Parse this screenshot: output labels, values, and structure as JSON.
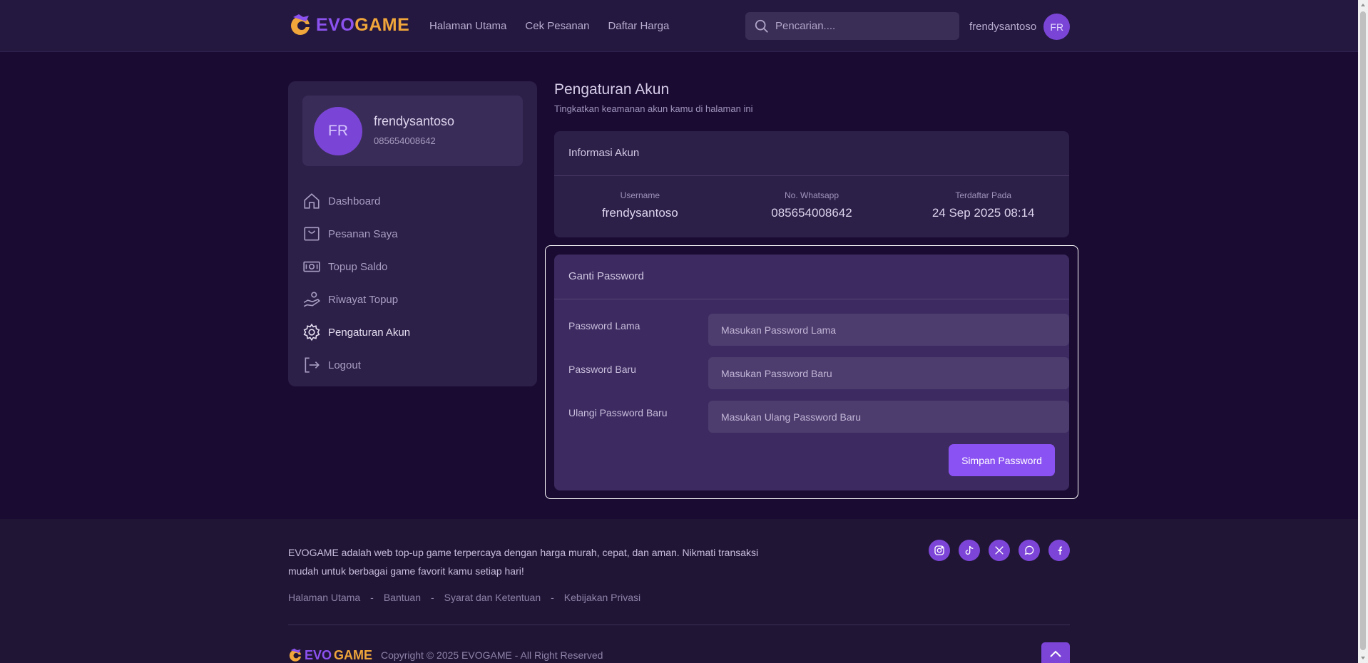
{
  "brand": {
    "part1": "EVO",
    "part2": "GAME",
    "accent": "#8b52f3",
    "orange": "#f0a63a"
  },
  "nav": {
    "links": [
      "Halaman Utama",
      "Cek Pesanan",
      "Daftar Harga"
    ],
    "search_placeholder": "Pencarian....",
    "username": "frendysantoso",
    "avatar_initials": "FR"
  },
  "sidebar": {
    "profile": {
      "initials": "FR",
      "name": "frendysantoso",
      "phone": "085654008642"
    },
    "items": [
      {
        "label": "Dashboard",
        "icon": "home-icon"
      },
      {
        "label": "Pesanan Saya",
        "icon": "shopping-bag-icon"
      },
      {
        "label": "Topup Saldo",
        "icon": "money-icon"
      },
      {
        "label": "Riwayat Topup",
        "icon": "hand-coins-icon"
      },
      {
        "label": "Pengaturan Akun",
        "icon": "gear-icon",
        "active": true
      },
      {
        "label": "Logout",
        "icon": "logout-icon"
      }
    ]
  },
  "main": {
    "title": "Pengaturan Akun",
    "subtitle": "Tingkatkan keamanan akun kamu di halaman ini",
    "info": {
      "header": "Informasi Akun",
      "fields": [
        {
          "label": "Username",
          "value": "frendysantoso"
        },
        {
          "label": "No. Whatsapp",
          "value": "085654008642"
        },
        {
          "label": "Terdaftar Pada",
          "value": "24 Sep 2025 08:14"
        }
      ]
    },
    "password": {
      "header": "Ganti Password",
      "fields": [
        {
          "label": "Password Lama",
          "placeholder": "Masukan Password Lama"
        },
        {
          "label": "Password Baru",
          "placeholder": "Masukan Password Baru"
        },
        {
          "label": "Ulangi Password Baru",
          "placeholder": "Masukan Ulang Password Baru"
        }
      ],
      "submit": "Simpan Password"
    }
  },
  "footer": {
    "description": "EVOGAME adalah web top-up game terpercaya dengan harga murah, cepat, dan aman. Nikmati transaksi mudah untuk berbagai game favorit kamu setiap hari!",
    "links": [
      "Halaman Utama",
      "Bantuan",
      "Syarat dan Ketentuan",
      "Kebijakan Privasi"
    ],
    "separator": "-",
    "copyright": "Copyright © 2025 EVOGAME - All Right Reserved",
    "socials": [
      "instagram-icon",
      "tiktok-icon",
      "x-icon",
      "whatsapp-icon",
      "facebook-icon"
    ]
  }
}
